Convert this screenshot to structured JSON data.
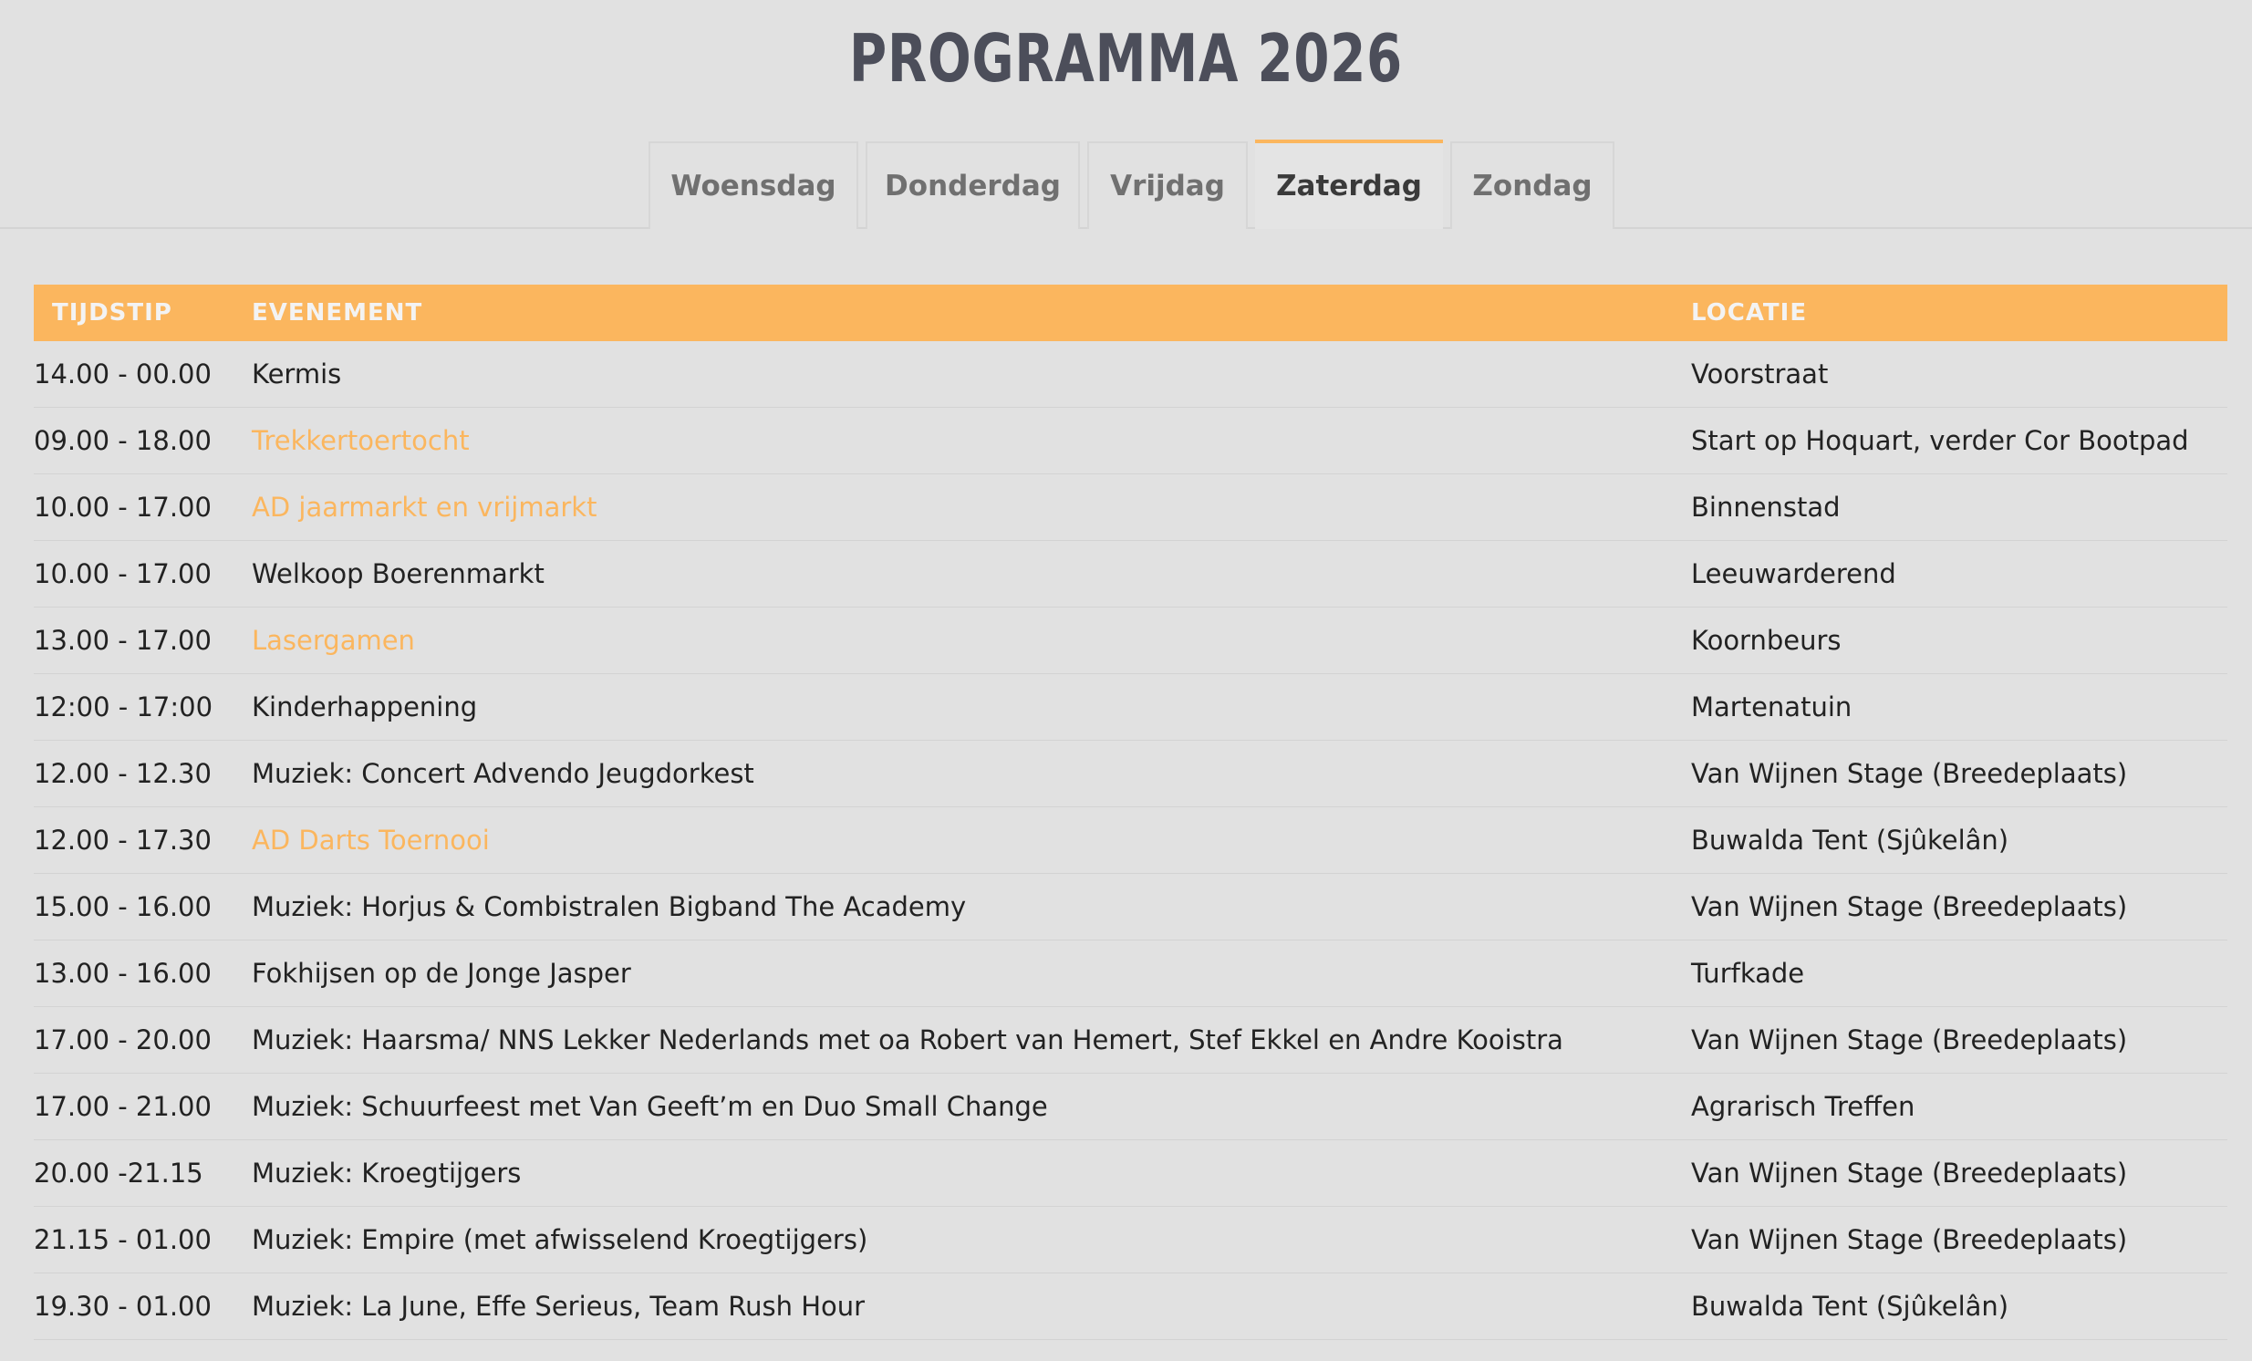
{
  "page": {
    "title": "PROGRAMMA 2026"
  },
  "tabs": [
    {
      "label": "Woensdag"
    },
    {
      "label": "Donderdag"
    },
    {
      "label": "Vrijdag"
    },
    {
      "label": "Zaterdag"
    },
    {
      "label": "Zondag"
    }
  ],
  "active_tab": "Zaterdag",
  "colors": {
    "accent": "#fbb65e",
    "background": "#e1e1e1",
    "title": "#4c4e5a"
  },
  "table": {
    "headers": {
      "time": "TIJDSTIP",
      "event": "EVENEMENT",
      "location": "LOCATIE"
    },
    "rows": [
      {
        "time": "14.00 - 00.00",
        "event": "Kermis",
        "location": "Voorstraat"
      },
      {
        "time": "09.00 - 18.00",
        "event": "Trekkertoertocht",
        "location": "Start op Hoquart, verder Cor Bootpad"
      },
      {
        "time": "10.00 - 17.00",
        "event": "AD jaarmarkt en vrijmarkt",
        "location": "Binnenstad"
      },
      {
        "time": "10.00 - 17.00",
        "event": "Welkoop Boerenmarkt",
        "location": "Leeuwarderend"
      },
      {
        "time": "13.00 - 17.00",
        "event": "Lasergamen",
        "location": "Koornbeurs"
      },
      {
        "time": "12:00 - 17:00",
        "event": "Kinderhappening",
        "location": "Martenatuin"
      },
      {
        "time": "12.00 - 12.30",
        "event": "Muziek: Concert Advendo Jeugdorkest",
        "location": "Van Wijnen Stage (Breedeplaats)"
      },
      {
        "time": "12.00 - 17.30",
        "event": "AD Darts Toernooi",
        "location": "Buwalda Tent (Sjûkelân)"
      },
      {
        "time": "15.00 - 16.00",
        "event": "Muziek: Horjus & Combistralen Bigband The Academy",
        "location": "Van Wijnen Stage (Breedeplaats)"
      },
      {
        "time": "13.00 - 16.00",
        "event": "Fokhijsen op de Jonge Jasper",
        "location": "Turfkade"
      },
      {
        "time": "17.00 - 20.00",
        "event": "Muziek: Haarsma/ NNS Lekker Nederlands met oa Robert van Hemert, Stef Ekkel en Andre Kooistra",
        "location": "Van Wijnen Stage (Breedeplaats)"
      },
      {
        "time": "17.00 - 21.00",
        "event": "Muziek: Schuurfeest met Van Geeft’m en Duo Small Change",
        "location": "Agrarisch Treffen"
      },
      {
        "time": "20.00 -21.15",
        "event": "Muziek: Kroegtijgers",
        "location": "Van Wijnen Stage (Breedeplaats)"
      },
      {
        "time": "21.15 - 01.00",
        "event": "Muziek: Empire (met afwisselend Kroegtijgers)",
        "location": "Van Wijnen Stage (Breedeplaats)"
      },
      {
        "time": "19.30 - 01.00",
        "event": "Muziek: La June, Effe Serieus, Team Rush Hour",
        "location": "Buwalda Tent (Sjûkelân)"
      }
    ]
  }
}
